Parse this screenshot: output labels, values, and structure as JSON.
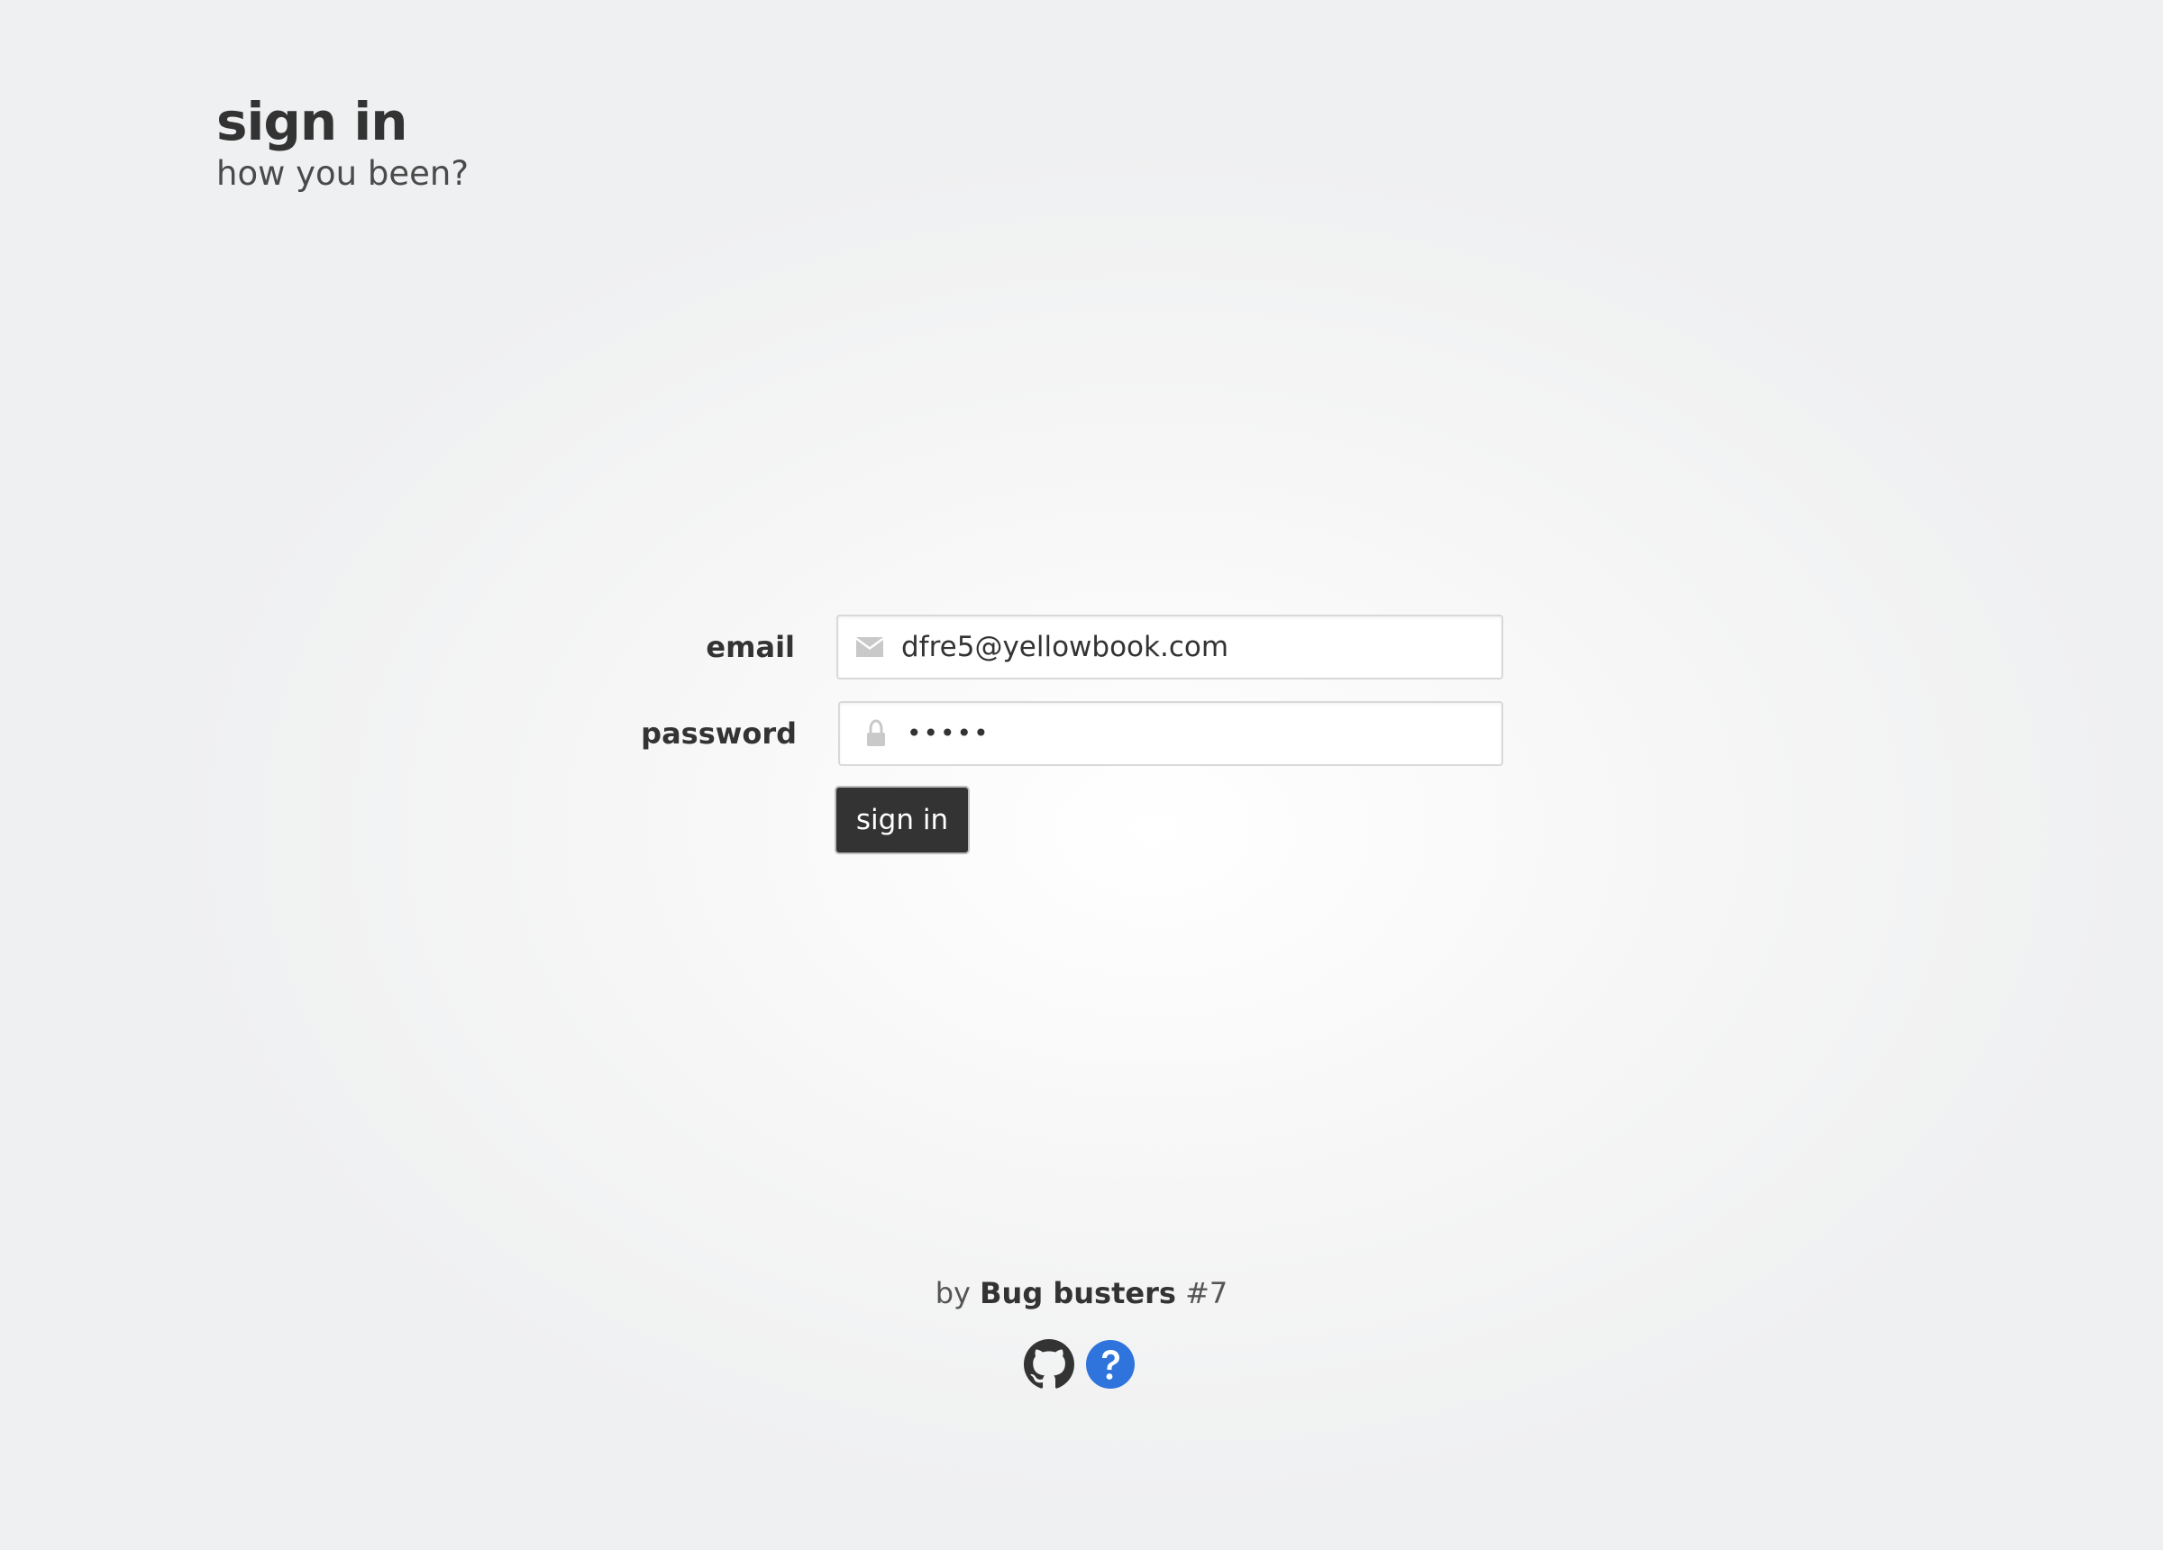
{
  "header": {
    "title": "sign in",
    "subtitle": "how you been?"
  },
  "form": {
    "email": {
      "label": "email",
      "value": "dfre5@yellowbook.com",
      "icon": "envelope-icon"
    },
    "password": {
      "label": "password",
      "value": "•••••",
      "icon": "lock-icon"
    },
    "submit_label": "sign in"
  },
  "footer": {
    "by_text": "by",
    "team_name": "Bug busters",
    "team_number": "#7",
    "links": [
      {
        "icon": "github-icon"
      },
      {
        "icon": "help-icon"
      }
    ]
  },
  "colors": {
    "text_primary": "#333333",
    "button_bg": "#333333",
    "help_icon_blue": "#2f74dc",
    "input_border": "#d9d9d9"
  }
}
